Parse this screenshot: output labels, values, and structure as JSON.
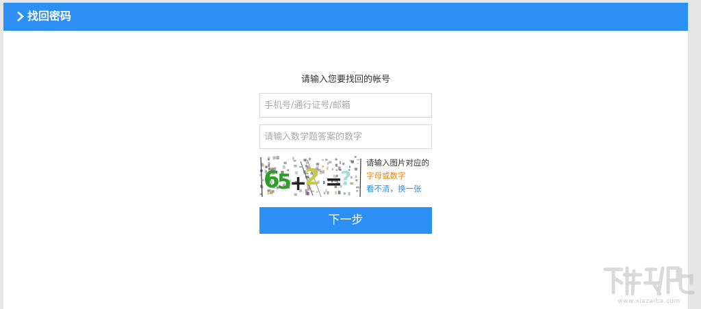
{
  "header": {
    "title": "找回密码",
    "icon": "chevron-right-icon",
    "background": "#2b8ff3"
  },
  "form": {
    "prompt": "请输入您要找回的帐号",
    "account_placeholder": "手机号/通行证号/邮箱",
    "answer_placeholder": "请输入数学题答案的数字",
    "captcha_text": "65+2=?",
    "captcha_hint_line1": "请输入图片对应的",
    "captcha_hint_line2": "字母或数字",
    "captcha_refresh": "看不清，换一张",
    "next_label": "下一步",
    "accent": "#2b8ff3",
    "hint_orange": "#f08200"
  },
  "watermark": {
    "text": "www.xiazaiba.com",
    "logo_icon": "xiazaiba-logo-icon"
  }
}
